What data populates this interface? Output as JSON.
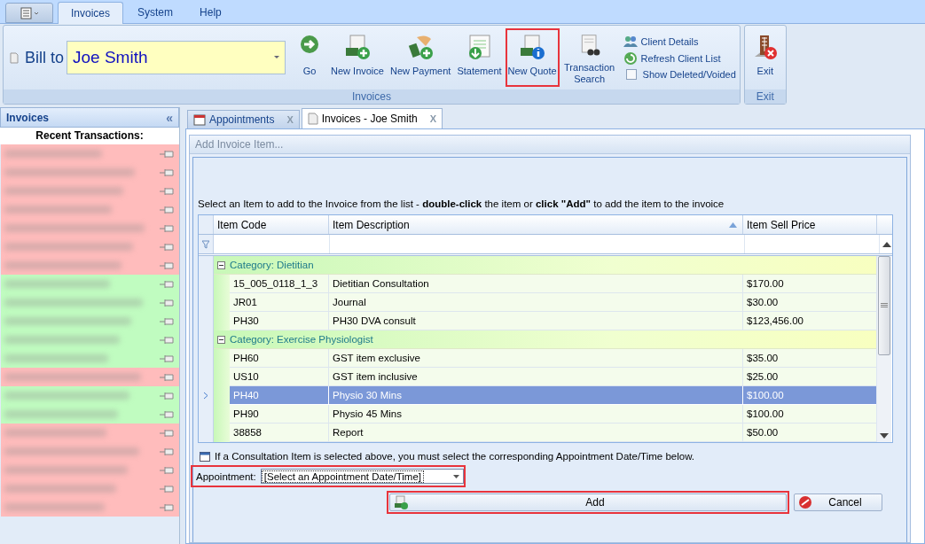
{
  "ribbon_tabs": [
    {
      "label": "Invoices",
      "selected": true
    },
    {
      "label": "System",
      "selected": false
    },
    {
      "label": "Help",
      "selected": false
    }
  ],
  "bill_to": {
    "label": "Bill to",
    "value": "Joe Smith"
  },
  "ribbon_buttons": [
    {
      "label": "Go",
      "highlighted": false
    },
    {
      "label": "New Invoice",
      "highlighted": false
    },
    {
      "label": "New Payment",
      "highlighted": false
    },
    {
      "label": "Statement",
      "highlighted": false
    },
    {
      "label": "New Quote",
      "highlighted": true
    },
    {
      "label": "Transaction Search",
      "highlighted": false
    }
  ],
  "ribbon_small": [
    {
      "kind": "link",
      "label": "Client Details"
    },
    {
      "kind": "link",
      "label": "Refresh Client List"
    },
    {
      "kind": "checkbox",
      "label": "Show Deleted/Voided",
      "checked": false
    }
  ],
  "ribbon_group_label": "Invoices",
  "exit_group": {
    "button": "Exit",
    "label": "Exit"
  },
  "sidebar": {
    "title": "Invoices",
    "collapse": "«",
    "heading": "Recent Transactions:",
    "transactions": [
      {
        "color": "#ffbcbc"
      },
      {
        "color": "#ffbcbc"
      },
      {
        "color": "#ffbcbc"
      },
      {
        "color": "#ffbcbc"
      },
      {
        "color": "#ffbcbc"
      },
      {
        "color": "#ffbcbc"
      },
      {
        "color": "#ffbcbc"
      },
      {
        "color": "#c0fcc0"
      },
      {
        "color": "#c0fcc0"
      },
      {
        "color": "#c0fcc0"
      },
      {
        "color": "#c0fcc0"
      },
      {
        "color": "#c0fcc0"
      },
      {
        "color": "#ffbcbc"
      },
      {
        "color": "#c0fcc0"
      },
      {
        "color": "#c0fcc0"
      },
      {
        "color": "#ffbcbc"
      },
      {
        "color": "#ffbcbc"
      },
      {
        "color": "#ffbcbc"
      },
      {
        "color": "#ffbcbc"
      },
      {
        "color": "#ffbcbc"
      }
    ]
  },
  "doc_tabs": [
    {
      "label": "Appointments",
      "close": "X",
      "selected": false
    },
    {
      "label": "Invoices - Joe Smith",
      "close": "X",
      "selected": true
    }
  ],
  "panel_title": "Add Invoice Item...",
  "instructions": "Select an Item to add to the Invoice from the list - **double-click** the item or **click \"Add\"** to add the item to the invoice",
  "grid": {
    "columns": [
      {
        "label": "Item Code",
        "sorted": false
      },
      {
        "label": "Item Description",
        "sorted": true
      },
      {
        "label": "Item Sell Price",
        "sorted": false
      }
    ],
    "groups": [
      {
        "title": "Category: Dietitian",
        "expanded": true,
        "rows": [
          {
            "code": "15_005_0118_1_3",
            "description": "Dietitian Consultation",
            "price": "$170.00",
            "selected": false
          },
          {
            "code": "JR01",
            "description": "Journal",
            "price": "$30.00",
            "selected": false
          },
          {
            "code": "PH30",
            "description": "PH30 DVA consult",
            "price": "$123,456.00",
            "selected": false
          }
        ]
      },
      {
        "title": "Category: Exercise Physiologist",
        "expanded": true,
        "rows": [
          {
            "code": "PH60",
            "description": "GST item exclusive",
            "price": "$35.00",
            "selected": false
          },
          {
            "code": "US10",
            "description": "GST item inclusive",
            "price": "$25.00",
            "selected": false
          },
          {
            "code": "PH40",
            "description": "Physio 30 Mins",
            "price": "$100.00",
            "selected": true
          },
          {
            "code": "PH90",
            "description": "Physio 45 Mins",
            "price": "$100.00",
            "selected": false
          },
          {
            "code": "38858",
            "description": "Report",
            "price": "$50.00",
            "selected": false
          }
        ]
      }
    ]
  },
  "note": "If a Consultation Item is selected above, you must select the corresponding Appointment Date/Time below.",
  "appointment": {
    "label": "Appointment:",
    "value": "[Select an Appointment Date/Time]",
    "highlighted": true
  },
  "buttons": [
    {
      "label": "Add",
      "highlighted": true
    },
    {
      "label": "Cancel",
      "highlighted": false
    }
  ]
}
